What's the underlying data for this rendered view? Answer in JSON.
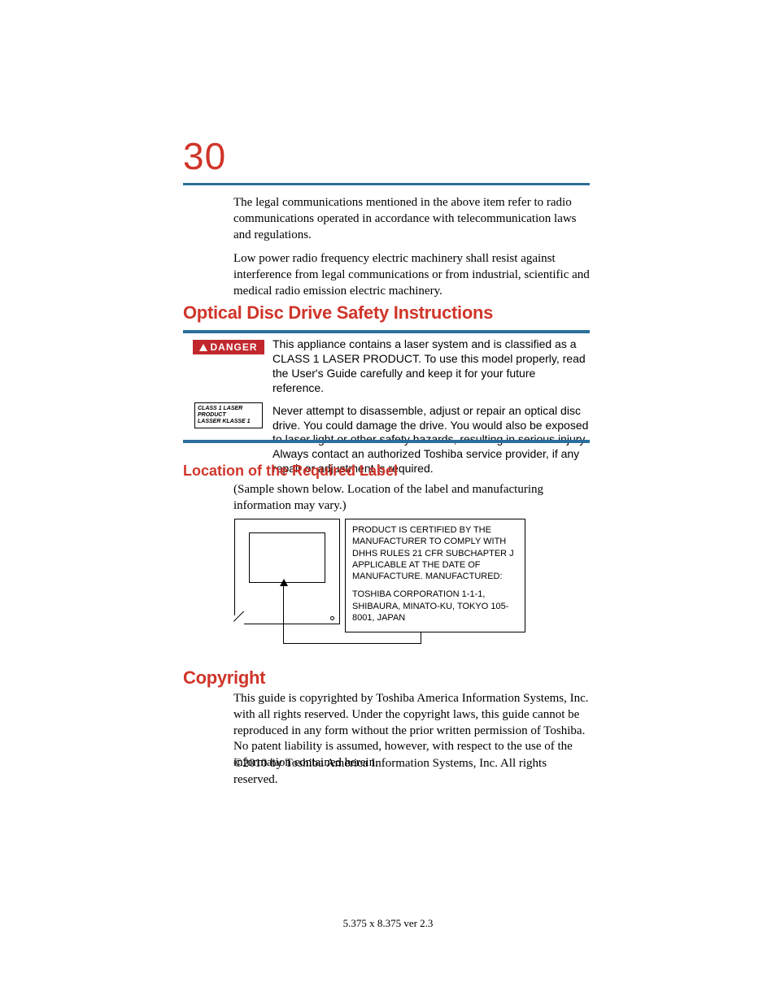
{
  "page_number": "30",
  "intro": {
    "p1": "The legal communications mentioned in the above item refer to radio communications operated in accordance with telecommunication laws and regulations.",
    "p2": "Low power radio frequency electric machinery shall resist against interference from legal communications or from industrial, scientific and medical radio emission electric machinery."
  },
  "optical": {
    "heading": "Optical Disc Drive Safety Instructions",
    "danger_label": "DANGER",
    "p1": "This appliance contains a laser system and is classified as a CLASS 1 LASER PRODUCT. To use this model properly, read the User's Guide carefully and keep it for your future reference.",
    "p2": "Never attempt to disassemble, adjust or repair an optical disc drive. You could damage the drive. You would also be exposed to laser light or other safety hazards, resulting in serious injury. Always contact an authorized Toshiba service provider, if any repair or adjustment is required.",
    "laser_label_line1": "CLASS 1 LASER PRODUCT",
    "laser_label_line2": "LASSER KLASSE 1"
  },
  "location": {
    "heading": "Location of the Required Label",
    "para": "(Sample shown below. Location of the label and manufacturing information may vary.)",
    "cert_p1": "PRODUCT IS CERTIFIED BY THE MANUFACTURER TO COMPLY WITH DHHS RULES 21 CFR SUBCHAPTER J APPLICABLE AT THE DATE OF MANUFACTURE. MANUFACTURED:",
    "cert_p2": "TOSHIBA CORPORATION 1-1-1, SHIBAURA, MINATO-KU, TOKYO 105-8001, JAPAN"
  },
  "copyright": {
    "heading": "Copyright",
    "p1": "This guide is copyrighted by Toshiba America Information Systems, Inc. with all rights reserved. Under the copyright laws, this guide cannot be reproduced in any form without the prior written permission of Toshiba. No patent liability is assumed, however, with respect to the use of the information contained herein.",
    "p2": "©2010 by Toshiba America Information Systems, Inc. All rights reserved."
  },
  "footer": "5.375 x 8.375 ver 2.3"
}
